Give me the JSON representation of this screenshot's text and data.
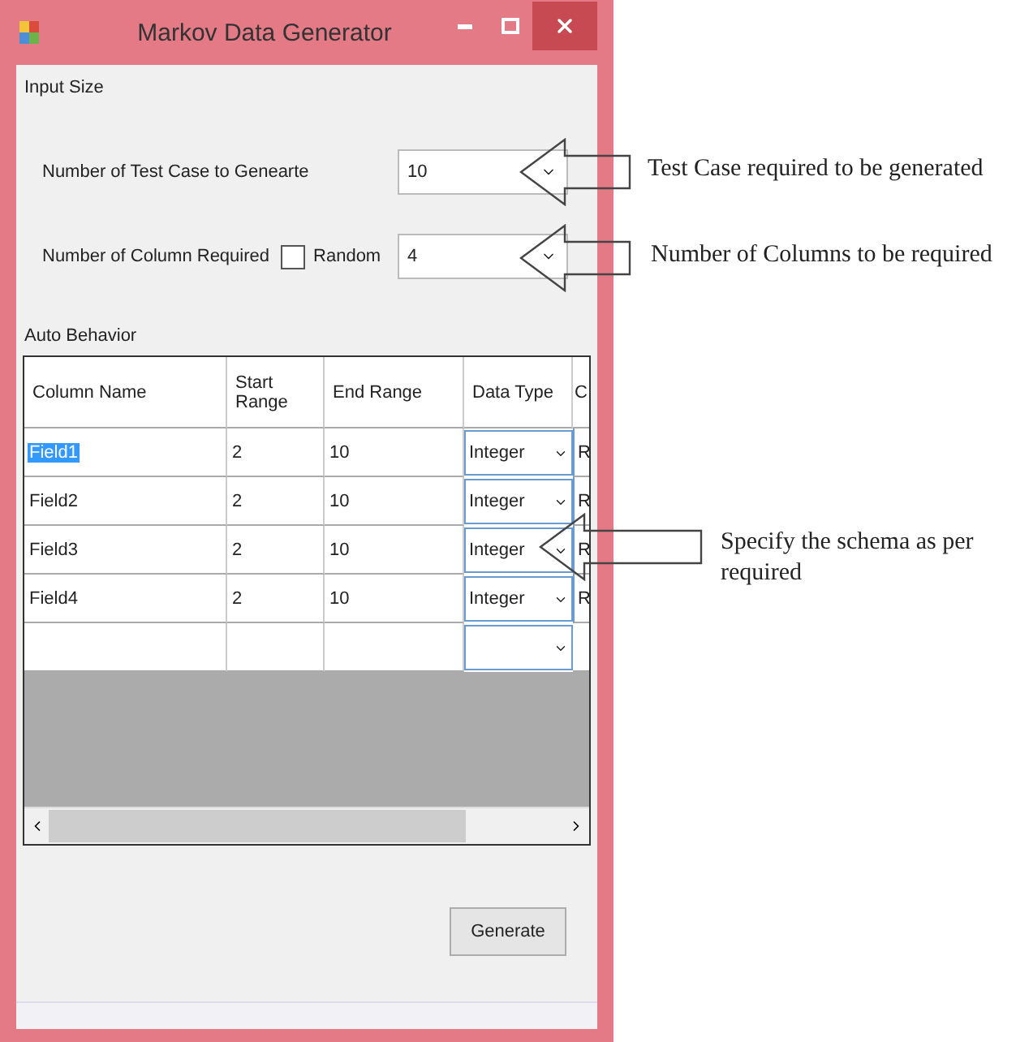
{
  "window": {
    "title": "Markov Data Generator"
  },
  "input_size": {
    "title": "Input Size",
    "test_cases": {
      "label": "Number of Test Case to Genearte",
      "value": "10"
    },
    "columns": {
      "label": "Number of Column Required",
      "random": {
        "label": "Random",
        "checked": false
      },
      "value": "4"
    }
  },
  "auto_behavior": {
    "title": "Auto Behavior",
    "table": {
      "columns": [
        "Column Name",
        "Start Range",
        "End Range",
        "Data Type",
        "C"
      ],
      "rows": [
        {
          "kind": "data",
          "cells": [
            "Field1",
            "2",
            "10",
            "Integer",
            "R"
          ],
          "selected": true
        },
        {
          "kind": "data",
          "cells": [
            "Field2",
            "2",
            "10",
            "Integer",
            "R"
          ],
          "selected": false
        },
        {
          "kind": "data",
          "cells": [
            "Field3",
            "2",
            "10",
            "Integer",
            "R"
          ],
          "selected": false
        },
        {
          "kind": "data",
          "cells": [
            "Field4",
            "2",
            "10",
            "Integer",
            "R"
          ],
          "selected": false
        },
        {
          "kind": "new",
          "selected": false
        }
      ]
    }
  },
  "generate_button": "Generate",
  "annotations": [
    {
      "text": "Test Case required to be generated"
    },
    {
      "text": "Number of Columns to be required"
    },
    {
      "text": "Specify the schema as per required"
    }
  ]
}
